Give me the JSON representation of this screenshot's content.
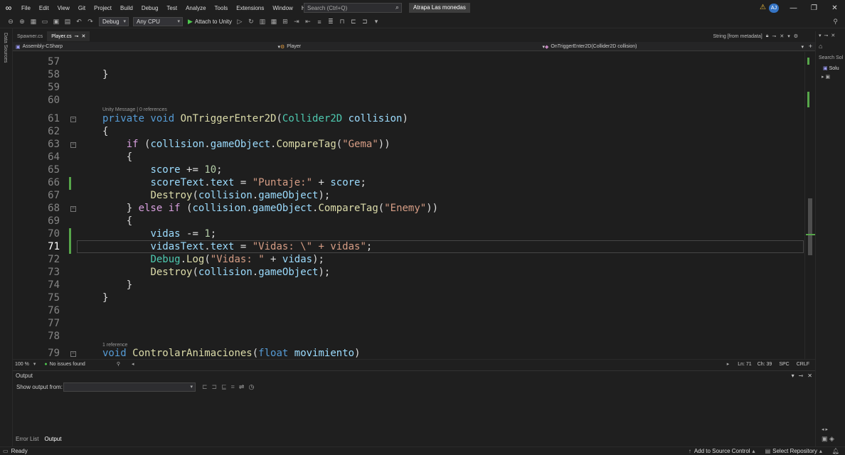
{
  "menu": {
    "items": [
      "File",
      "Edit",
      "View",
      "Git",
      "Project",
      "Build",
      "Debug",
      "Test",
      "Analyze",
      "Tools",
      "Extensions",
      "Window",
      "Help"
    ],
    "search_placeholder": "Search (Ctrl+Q)",
    "solution_name": "Atrapa Las monedas",
    "user_initials": "AJ"
  },
  "toolbar": {
    "config": "Debug",
    "platform": "Any CPU",
    "attach_label": "Attach to Unity"
  },
  "left_strip": {
    "label": "Data Sources"
  },
  "tabs": {
    "items": [
      {
        "label": "Spawner.cs",
        "active": false
      },
      {
        "label": "Player.cs",
        "active": true
      }
    ],
    "metadata_tab": "String [from metadata]"
  },
  "navbar": {
    "project": "Assembly-CSharp",
    "class": "Player",
    "member": "OnTriggerEnter2D(Collider2D collision)"
  },
  "editor": {
    "line_numbers": [
      "57",
      "58",
      "59",
      "60",
      "61",
      "62",
      "63",
      "64",
      "65",
      "66",
      "67",
      "68",
      "69",
      "70",
      "71",
      "72",
      "73",
      "74",
      "75",
      "76",
      "77",
      "78",
      "79"
    ],
    "current_line": "71",
    "codelens": [
      "Unity Message | 0 references",
      "1 reference"
    ]
  },
  "status": {
    "zoom": "100 %",
    "issues": "No issues found",
    "ln": "Ln: 71",
    "ch": "Ch: 39",
    "spc": "SPC",
    "crlf": "CRLF"
  },
  "output": {
    "title": "Output",
    "show_from": "Show output from:",
    "select_value": ""
  },
  "bottom_tabs": [
    "Error List",
    "Output"
  ],
  "right_panel": {
    "search": "Search Sol",
    "item": "Solu"
  },
  "statusbar": {
    "ready": "Ready",
    "source_control": "Add to Source Control",
    "repository": "Select Repository"
  },
  "colors": {
    "keyword": "#569cd6",
    "type": "#4ec9b0",
    "method": "#dcdcaa",
    "variable": "#9cdcfe",
    "string": "#d69d85",
    "number": "#b5cea8",
    "control": "#d8a0df",
    "line_number": "#858585",
    "change_bar": "#57a64a"
  }
}
